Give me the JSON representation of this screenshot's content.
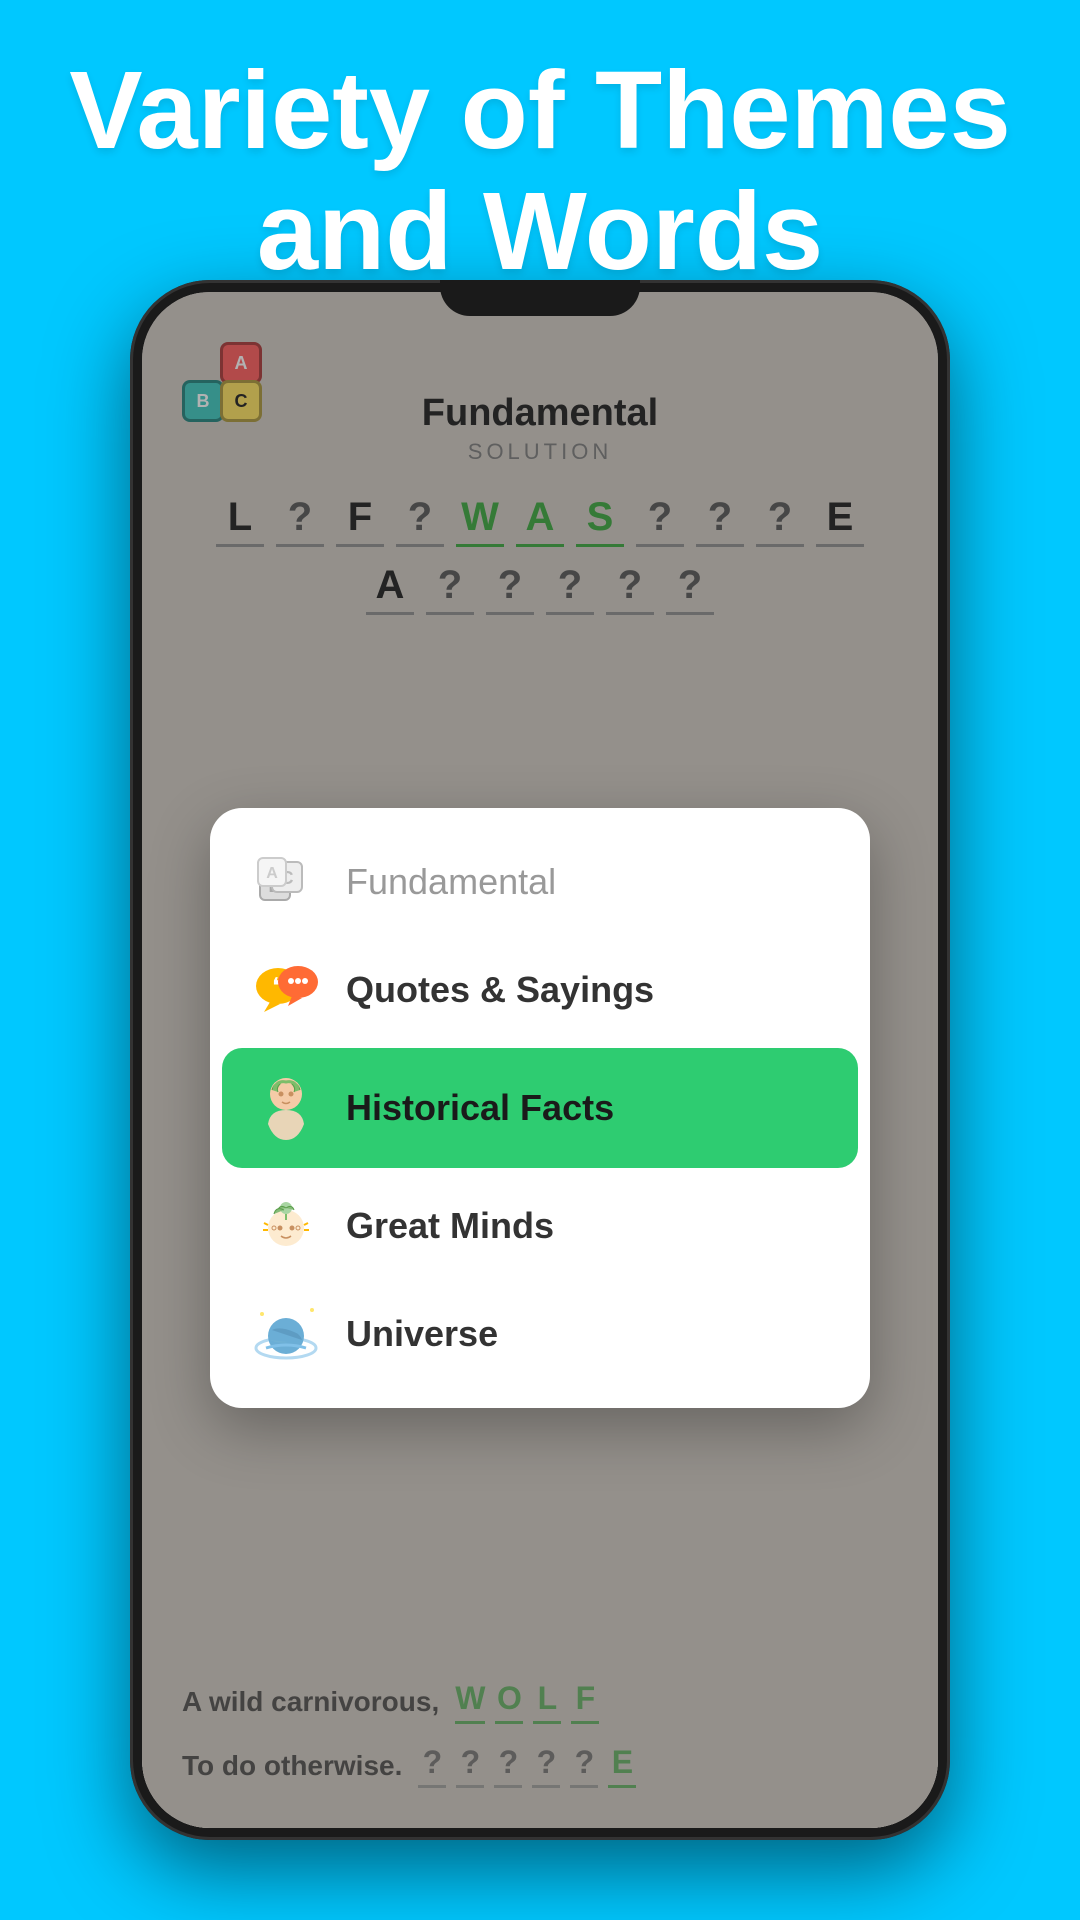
{
  "header": {
    "title_line1": "Variety of Themes",
    "title_line2": "and Words"
  },
  "phone": {
    "app_title": "Fundamental",
    "app_subtitle": "SOLUTION",
    "puzzle_row1": [
      "L",
      "?",
      "F",
      "?",
      "W",
      "A",
      "S",
      "?",
      "?",
      "?",
      "E"
    ],
    "puzzle_row2": [
      "A",
      "?",
      "?",
      "?",
      "?",
      "?"
    ],
    "bottom_clue1_text": "A wild carnivorous,",
    "bottom_clue1_answer": [
      "W",
      "O",
      "L",
      "F"
    ],
    "bottom_clue2_text": "To do otherwise.",
    "bottom_clue2_answer": [
      "?",
      "?",
      "?",
      "?",
      "?",
      "E"
    ]
  },
  "menu": {
    "items": [
      {
        "id": "fundamental",
        "label": "Fundamental",
        "icon": "🎲",
        "active": false,
        "muted": true
      },
      {
        "id": "quotes-sayings",
        "label": "Quotes & Sayings",
        "icon": "💬",
        "active": false,
        "muted": false
      },
      {
        "id": "historical-facts",
        "label": "Historical Facts",
        "icon": "🏛️",
        "active": true,
        "muted": false
      },
      {
        "id": "great-minds",
        "label": "Great Minds",
        "icon": "🧠",
        "active": false,
        "muted": false
      },
      {
        "id": "universe",
        "label": "Universe",
        "icon": "🪐",
        "active": false,
        "muted": false
      }
    ]
  }
}
